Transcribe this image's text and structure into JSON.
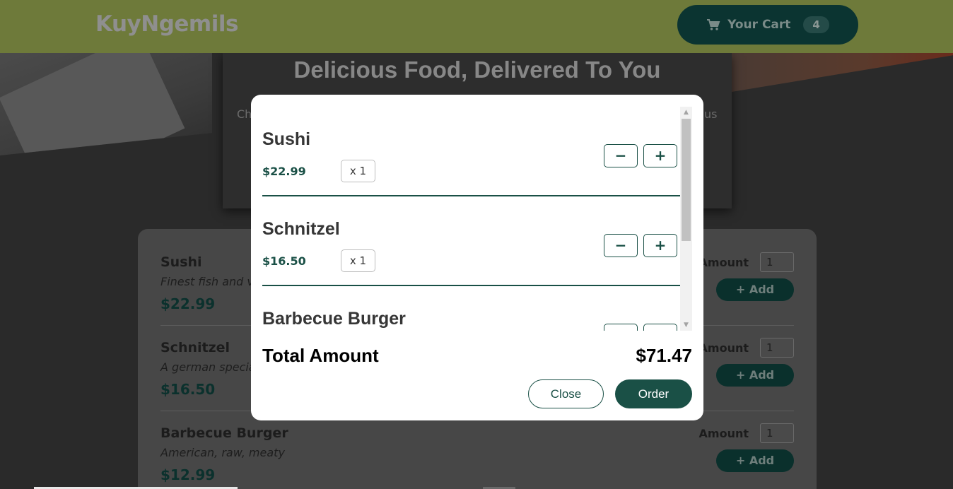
{
  "header": {
    "logo": "KuyNgemils",
    "cart_label": "Your Cart",
    "cart_count": "4",
    "cart_icon": "shopping-cart-icon"
  },
  "hero": {
    "title": "Delicious Food, Delivered To You",
    "text_left": "Ch",
    "text_right": "us"
  },
  "menu": {
    "items": [
      {
        "name": "Sushi",
        "description": "Finest fish and ve",
        "price": "$22.99",
        "amount_label": "Amount",
        "amount_value": "1",
        "add_label": "+ Add"
      },
      {
        "name": "Schnitzel",
        "description": "A german special",
        "price": "$16.50",
        "amount_label": "Amount",
        "amount_value": "1",
        "add_label": "+ Add"
      },
      {
        "name": "Barbecue Burger",
        "description": "American, raw, meaty",
        "price": "$12.99",
        "amount_label": "Amount",
        "amount_value": "1",
        "add_label": "+ Add"
      }
    ]
  },
  "cart_modal": {
    "items": [
      {
        "name": "Sushi",
        "price": "$22.99",
        "quantity": "x 1",
        "minus": "−",
        "plus": "+"
      },
      {
        "name": "Schnitzel",
        "price": "$16.50",
        "quantity": "x 1",
        "minus": "−",
        "plus": "+"
      },
      {
        "name": "Barbecue Burger",
        "price": "",
        "quantity": "",
        "minus": "",
        "plus": ""
      }
    ],
    "total_label": "Total Amount",
    "total_value": "$71.47",
    "close_label": "Close",
    "order_label": "Order"
  },
  "colors": {
    "header_bg": "#6e7a3a",
    "primary": "#1a5046",
    "dark_teal": "#0b3431"
  }
}
